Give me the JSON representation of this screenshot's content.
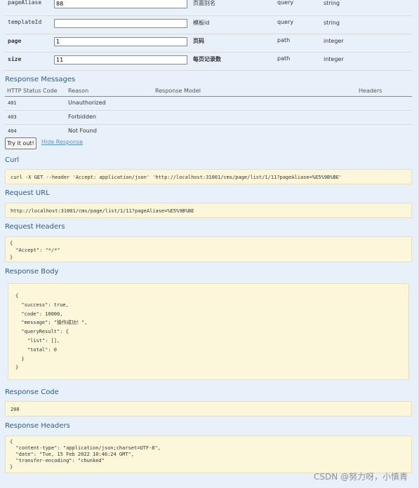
{
  "params": [
    {
      "name": "pageAliase",
      "value": "88",
      "description": "页面别名",
      "param_type": "query",
      "data_type": "string",
      "bold": false
    },
    {
      "name": "templateId",
      "value": "",
      "description": "模板id",
      "param_type": "query",
      "data_type": "string",
      "bold": false
    },
    {
      "name": "page",
      "value": "1",
      "description": "页码",
      "param_type": "path",
      "data_type": "integer",
      "bold": true
    },
    {
      "name": "size",
      "value": "11",
      "description": "每页记录数",
      "param_type": "path",
      "data_type": "integer",
      "bold": true
    }
  ],
  "response_messages": {
    "title": "Response Messages",
    "columns": [
      "HTTP Status Code",
      "Reason",
      "Response Model",
      "Headers"
    ],
    "rows": [
      {
        "code": "401",
        "reason": "Unauthorized"
      },
      {
        "code": "403",
        "reason": "Forbidden"
      },
      {
        "code": "404",
        "reason": "Not Found"
      }
    ]
  },
  "actions": {
    "try_label": "Try it out!",
    "hide_label": "Hide Response"
  },
  "curl": {
    "title": "Curl",
    "command": "curl -X GET --header 'Accept: application/json' 'http://localhost:31001/cms/page/list/1/11?pageAliase=%E5%9B%BE'"
  },
  "request_url": {
    "title": "Request URL",
    "value": "http://localhost:31001/cms/page/list/1/11?pageAliase=%E5%9B%BE"
  },
  "request_headers": {
    "title": "Request Headers",
    "body": "{\n  \"Accept\": \"*/*\"\n}"
  },
  "response_body": {
    "title": "Response Body",
    "body": "{\n  \"success\": true,\n  \"code\": 10000,\n  \"message\": \"操作成功！\",\n  \"queryResult\": {\n    \"list\": [],\n    \"total\": 0\n  }\n}"
  },
  "response_code": {
    "title": "Response Code",
    "value": "200"
  },
  "response_headers": {
    "title": "Response Headers",
    "body": "{\n  \"content-type\": \"application/json;charset=UTF-8\",\n  \"date\": \"Tue, 15 Feb 2022 10:46:24 GMT\",\n  \"transfer-encoding\": \"chunked\"\n}"
  },
  "watermark": "CSDN @努力呀，小慎青",
  "colors": {
    "panel_bg": "#e8f1fa",
    "heading": "#2c5d8c",
    "code_box_bg": "#fcf6db",
    "link": "#5a8fc3"
  }
}
